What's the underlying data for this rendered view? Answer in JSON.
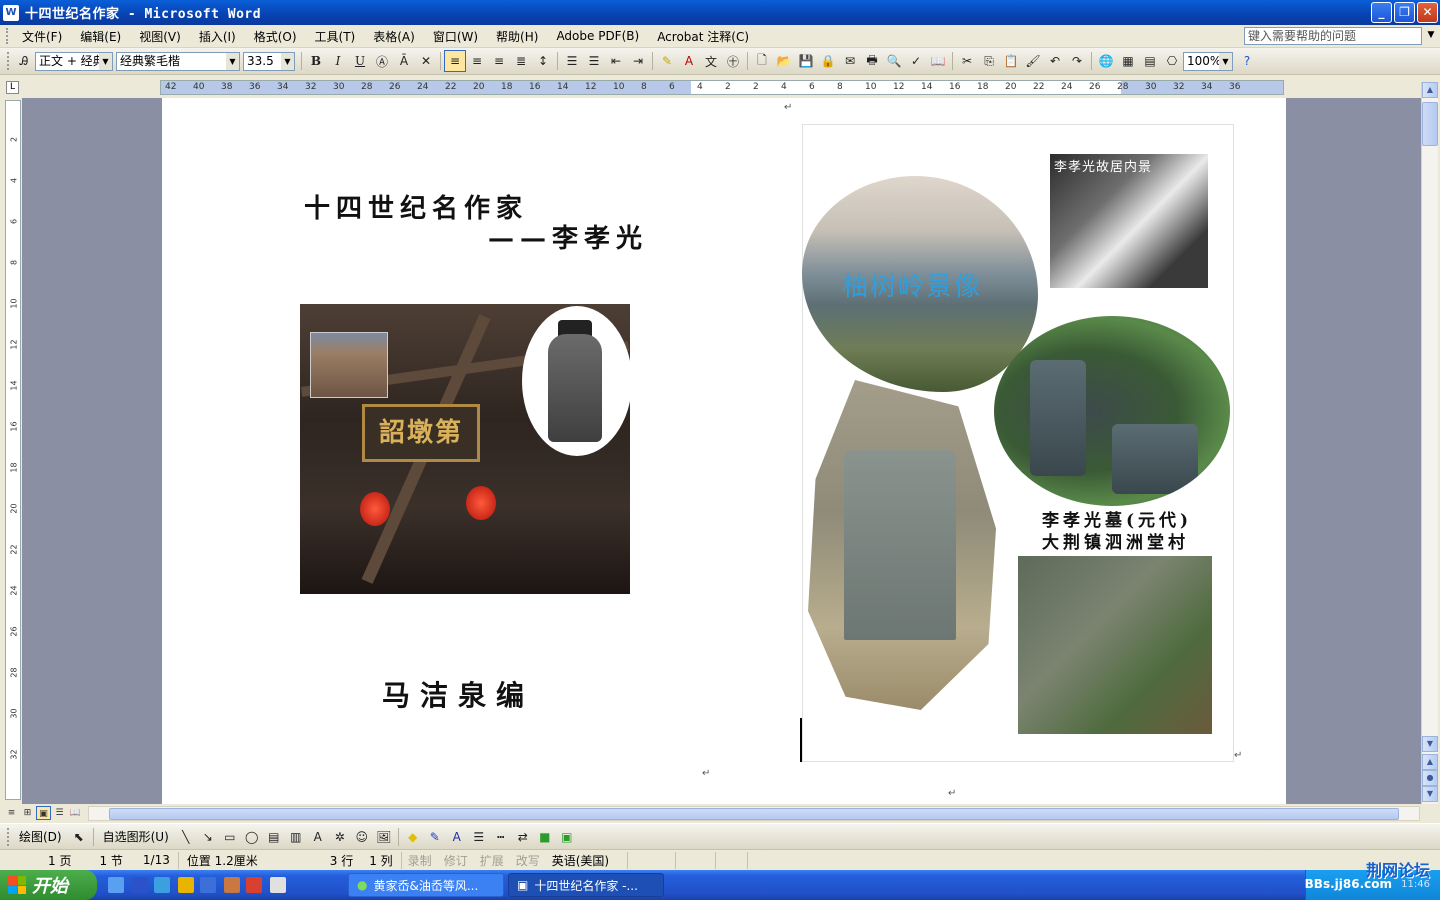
{
  "window": {
    "title": "十四世纪名作家 - Microsoft Word",
    "app_icon": "W",
    "controls": [
      "_",
      "❐",
      "✕"
    ]
  },
  "menu": {
    "items": [
      "文件(F)",
      "编辑(E)",
      "视图(V)",
      "插入(I)",
      "格式(O)",
      "工具(T)",
      "表格(A)",
      "窗口(W)",
      "帮助(H)",
      "Adobe PDF(B)",
      "Acrobat 注释(C)"
    ],
    "help_placeholder": "键入需要帮助的问题"
  },
  "toolbar": {
    "style": "正文 + 经典",
    "font": "经典繁毛楷",
    "size": "33.5",
    "bold": "B",
    "italic": "I",
    "underline": "U",
    "zoom": "100%"
  },
  "ruler": {
    "ticks": [
      "42",
      "40",
      "38",
      "36",
      "34",
      "32",
      "30",
      "28",
      "26",
      "24",
      "22",
      "20",
      "18",
      "16",
      "14",
      "12",
      "10",
      "8",
      "6",
      "4",
      "2",
      "2",
      "4",
      "6",
      "8",
      "10",
      "12",
      "14",
      "16",
      "18",
      "20",
      "22",
      "24",
      "26",
      "28",
      "30",
      "32",
      "34",
      "36"
    ],
    "vticks": [
      "2",
      "4",
      "6",
      "8",
      "10",
      "12",
      "14",
      "16",
      "18",
      "20",
      "22",
      "24",
      "26",
      "28",
      "30",
      "32"
    ]
  },
  "document": {
    "title": "十四世纪名作家",
    "subtitle": "——李孝光",
    "editor": "马洁泉编",
    "photo_plaque": "詔墩第",
    "scene_caption": "柚树岭景像",
    "bw_caption": "李孝光故居内景",
    "grave_caption_line1": "李孝光墓(元代)",
    "grave_caption_line2": "大荆镇泗洲堂村",
    "para_mark": "↵"
  },
  "drawbar": {
    "draw": "绘图(D)",
    "autoshapes": "自选图形(U)"
  },
  "status": {
    "page": "1 页",
    "section": "1 节",
    "pages": "1/13",
    "position": "位置 1.2厘米",
    "line": "3 行",
    "col": "1 列",
    "rec": "录制",
    "trk": "修订",
    "ext": "扩展",
    "ovr": "改写",
    "lang": "英语(美国)"
  },
  "taskbar": {
    "start": "开始",
    "task1": "黄家岙&油岙等风...",
    "task2": "十四世纪名作家 -...",
    "forum_logo": "荆网论坛",
    "forum_url": "BBs.jj86.com",
    "time": "11:46"
  },
  "colors": {
    "titlebar": "#0a5fd8",
    "workspace": "#8b8fa3",
    "start": "#2f8b2f",
    "taskbar": "#245edb"
  }
}
